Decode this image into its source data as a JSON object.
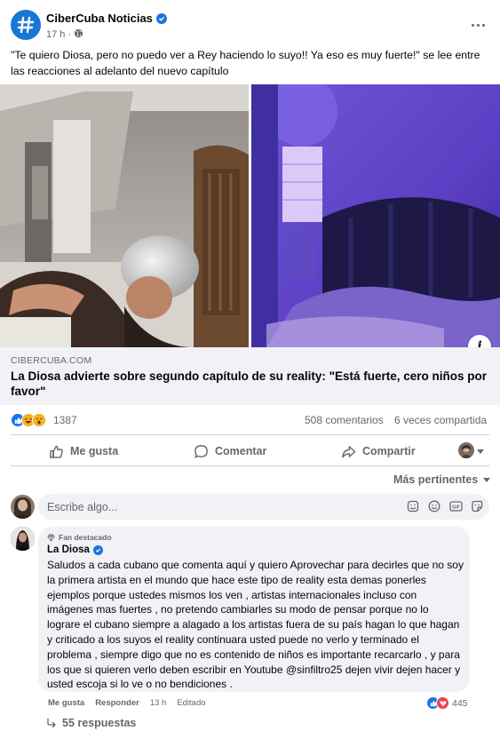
{
  "post": {
    "page_name": "CiberCuba Noticias",
    "time": "17 h",
    "text": "\"Te quiero Diosa, pero no puedo ver a Rey haciendo lo suyo!! Ya eso es muy fuerte!\"  se lee entre las reacciones al adelanto del nuevo capítulo"
  },
  "link": {
    "domain": "CIBERCUBA.COM",
    "title": "La Diosa advierte sobre segundo capítulo de su reality: \"Está fuerte, cero niños por favor\"",
    "info_label": "i"
  },
  "stats": {
    "reactions_count": "1387",
    "comments": "508 comentarios",
    "shares": "6 veces compartida"
  },
  "actions": {
    "like": "Me gusta",
    "comment": "Comentar",
    "share": "Compartir"
  },
  "sort": {
    "label": "Más pertinentes"
  },
  "comment_input": {
    "placeholder": "Escribe algo..."
  },
  "featured_comment": {
    "badge": "Fan destacado",
    "author": "La Diosa",
    "text": "Saludos a cada cubano que comenta aquí y quiero Aprovechar para decirles que no soy la primera artista en el mundo que hace este tipo de reality esta demas ponerles ejemplos porque ustedes mismos los ven , artistas internacionales incluso con imágenes mas fuertes , no pretendo cambiarles su modo de pensar porque no lo lograre el cubano siempre a alagado a los artistas fuera de su país hagan lo que hagan y criticado a los suyos el reality continuara usted puede no verlo y terminado el problema , siempre digo que no es contenido de niños es importante recarcarlo , y para los que si quieren verlo deben escribir en Youtube @sinfiltro25 dejen vivir dejen hacer y usted escoja si lo ve o no bendiciones .",
    "like": "Me gusta",
    "reply": "Responder",
    "time": "13 h",
    "edited": "Editado",
    "reactions": "445",
    "replies": "55 respuestas"
  },
  "colors": {
    "brand": "#1877d4",
    "like_blue": "#1b74e4",
    "love_red": "#f33e58",
    "haha_yellow": "#f7b125"
  },
  "icons": [
    "globe-icon",
    "verified-icon",
    "more-icon",
    "info-icon",
    "like-icon",
    "love-icon",
    "haha-icon",
    "wow-icon",
    "comment-icon",
    "share-icon",
    "caret-down-icon",
    "sticker-icon",
    "emoji-icon",
    "gif-icon",
    "avatar-sticker-icon",
    "reply-arrow-icon",
    "fan-badge-icon"
  ]
}
